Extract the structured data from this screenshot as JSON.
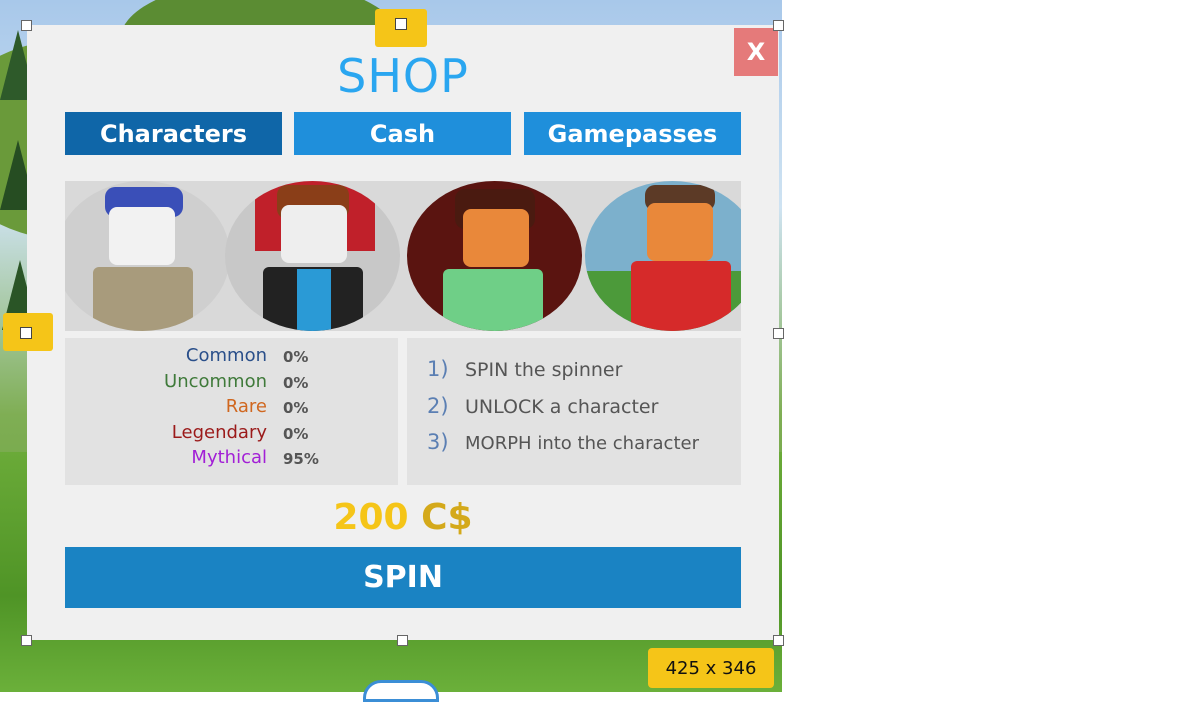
{
  "shop": {
    "title": "SHOP",
    "close_label": "X",
    "tabs": [
      {
        "label": "Characters",
        "active": true
      },
      {
        "label": "Cash",
        "active": false
      },
      {
        "label": "Gamepasses",
        "active": false
      }
    ],
    "rarities": [
      {
        "name": "Common",
        "pct": "0%",
        "color": "#2a4f8a"
      },
      {
        "name": "Uncommon",
        "pct": "0%",
        "color": "#3f7a3a"
      },
      {
        "name": "Rare",
        "pct": "0%",
        "color": "#d0671f"
      },
      {
        "name": "Legendary",
        "pct": "0%",
        "color": "#9b1a1a"
      },
      {
        "name": "Mythical",
        "pct": "95%",
        "color": "#a21fd6"
      }
    ],
    "steps": [
      {
        "num": "1)",
        "text": "SPIN the spinner"
      },
      {
        "num": "2)",
        "text": "UNLOCK a character"
      },
      {
        "num": "3)",
        "text": "MORPH into the character"
      }
    ],
    "price_amount": "200",
    "price_currency": "C$",
    "spin_label": "SPIN"
  },
  "editor": {
    "size_label": "425 x 346"
  },
  "colors": {
    "tab_active": "#0f66a8",
    "tab_inactive": "#1f8fdb",
    "spin": "#1a83c3",
    "title": "#2aa6f0",
    "close": "#e57a7a",
    "selection_handle": "#f5c518"
  }
}
